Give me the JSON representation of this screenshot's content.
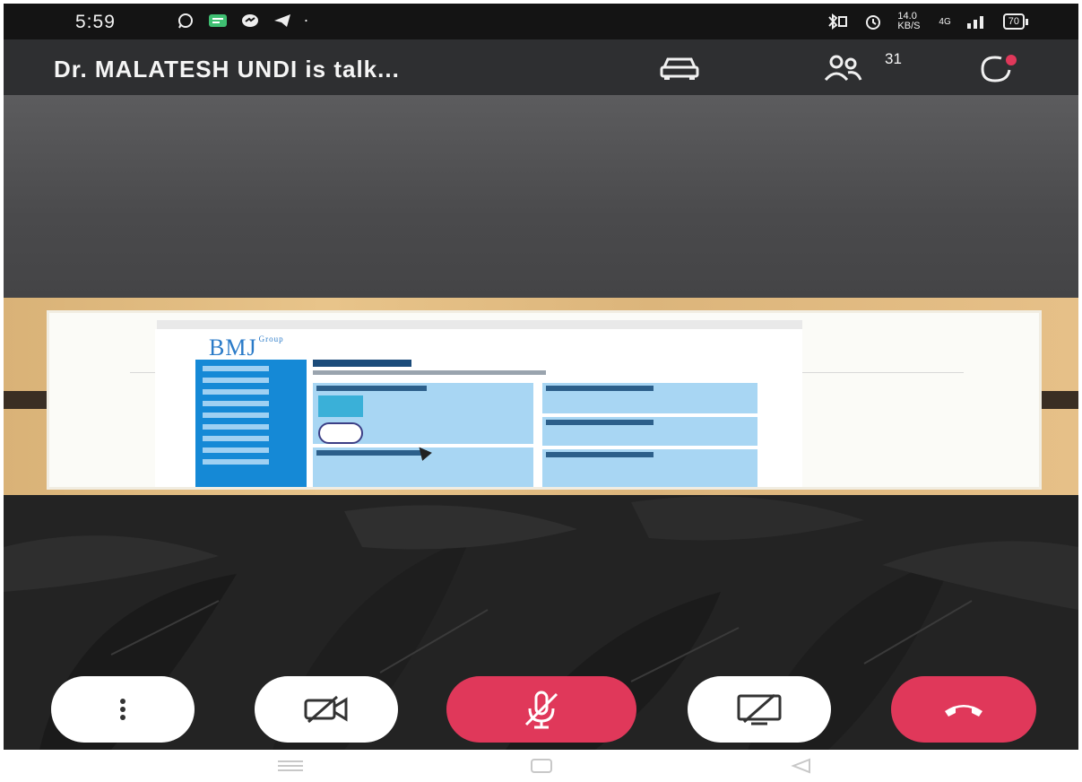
{
  "status_bar": {
    "time": "5:59",
    "network_speed": "14.0 KB/S",
    "signal_label": "4G",
    "battery": "70"
  },
  "header": {
    "title": "Dr. MALATESH UNDI is talk...",
    "participant_count": "31"
  },
  "shared_screen": {
    "logo_text": "BMJ",
    "logo_sub": "Group"
  },
  "controls": {
    "items": [
      {
        "name": "more-options",
        "icon": "more-vert-icon"
      },
      {
        "name": "camera-off",
        "icon": "video-off-icon"
      },
      {
        "name": "mute-mic",
        "icon": "mic-off-icon"
      },
      {
        "name": "screen-share-off",
        "icon": "screen-share-off-icon"
      },
      {
        "name": "end-call",
        "icon": "call-end-icon"
      }
    ]
  },
  "colors": {
    "accent_red": "#e0385a",
    "header_bg": "#2e2f31",
    "status_bar_bg": "#141414"
  }
}
